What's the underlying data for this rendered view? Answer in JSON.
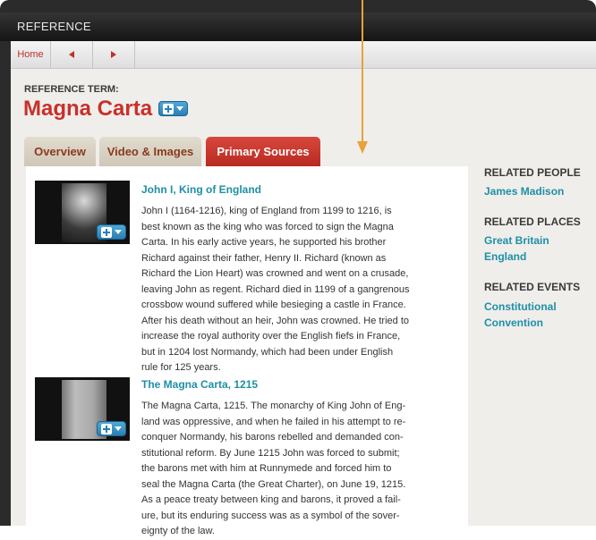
{
  "window": {
    "title": "REFERENCE"
  },
  "nav": {
    "home_label": "Home",
    "back_icon": "triangle-left",
    "forward_icon": "triangle-right"
  },
  "reference": {
    "label": "REFERENCE TERM:",
    "title": "Magna Carta"
  },
  "tabs": [
    {
      "label": "Overview",
      "active": false
    },
    {
      "label": "Video & Images",
      "active": false
    },
    {
      "label": "Primary Sources",
      "active": true
    }
  ],
  "entries": [
    {
      "title": "John I, King of England",
      "body": "John I (1164-1216), king of England from 1199 to 1216, is\nbest known as the king who was forced to sign the Magna\nCarta. In his early active years, he supported his brother\nRichard against their father, Henry II. Richard (known as\nRichard the Lion Heart) was crowned and went on a crusade,\nleaving John as regent. Richard died in 1199 of a gangrenous\ncrossbow wound suffered while besieging a castle in France.\nAfter his death without an heir, John was crowned. He tried to\nincrease the royal authority over the English fiefs in France,\nbut in 1204 lost Normandy, which had been under English\nrule for 125 years."
    },
    {
      "title": "The Magna Carta, 1215",
      "body": "The Magna Carta, 1215. The monarchy of King John of Eng-\nland was oppressive, and when he failed in his attempt to re-\nconquer Normandy, his barons rebelled and demanded con-\nstitutional reform. By June 1215 John was forced to submit;\nthe barons met with him at Runnymede and forced him to\nseal the Magna Carta (the Great Charter), on June 19, 1215.\nAs a peace treaty between king and barons, it proved a fail-\nure, but its enduring success was as a symbol of the sover-\neignty of the law."
    }
  ],
  "related": {
    "people_heading": "RELATED PEOPLE",
    "people": [
      "James Madison"
    ],
    "places_heading": "RELATED PLACES",
    "places": [
      "Great Britain",
      "England"
    ],
    "events_heading": "RELATED EVENTS",
    "events": [
      "Constitutional\nConvention"
    ]
  },
  "colors": {
    "accent_red": "#c8302b",
    "link_teal": "#1f8fa6",
    "annotation_arrow": "#e8a23a"
  }
}
